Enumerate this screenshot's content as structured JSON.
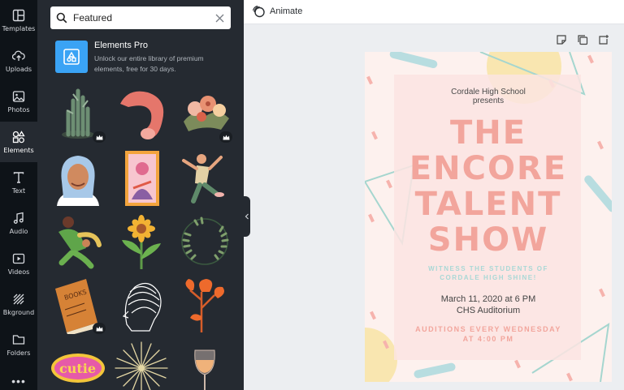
{
  "sidebar": {
    "items": [
      {
        "label": "Templates",
        "icon": "templates-icon"
      },
      {
        "label": "Uploads",
        "icon": "upload-icon"
      },
      {
        "label": "Photos",
        "icon": "image-icon"
      },
      {
        "label": "Elements",
        "icon": "shapes-icon",
        "active": true
      },
      {
        "label": "Text",
        "icon": "text-icon"
      },
      {
        "label": "Audio",
        "icon": "music-icon"
      },
      {
        "label": "Videos",
        "icon": "video-icon"
      },
      {
        "label": "Bkground",
        "icon": "background-icon"
      },
      {
        "label": "Folders",
        "icon": "folder-icon"
      }
    ],
    "more_label": "•••"
  },
  "search": {
    "value": "Featured"
  },
  "promo": {
    "title": "Elements Pro",
    "description_line1": "Unlock our entire library of premium",
    "description_line2": "elements, free for 30 days."
  },
  "elements": [
    {
      "name": "cactus-plant",
      "premium": true
    },
    {
      "name": "pink-arch",
      "premium": false
    },
    {
      "name": "flower-bouquet",
      "premium": true
    },
    {
      "name": "woman-portrait",
      "premium": false
    },
    {
      "name": "tarot-card",
      "premium": false
    },
    {
      "name": "dancing-person",
      "premium": false
    },
    {
      "name": "jumping-person",
      "premium": false
    },
    {
      "name": "sunflower",
      "premium": false
    },
    {
      "name": "leaf-wreath",
      "premium": false
    },
    {
      "name": "books",
      "premium": true
    },
    {
      "name": "line-face",
      "premium": false
    },
    {
      "name": "orange-flowers",
      "premium": false
    },
    {
      "name": "cutie-sticker",
      "premium": false
    },
    {
      "name": "firework",
      "premium": false
    },
    {
      "name": "wine-glass",
      "premium": false
    }
  ],
  "topbar": {
    "animate_label": "Animate"
  },
  "poster": {
    "school_line1": "Cordale High School",
    "school_line2": "presents",
    "title_lines": [
      "THE",
      "ENCORE",
      "TALENT",
      "SHOW"
    ],
    "witness_line1": "WITNESS THE STUDENTS OF",
    "witness_line2": "CORDALE HIGH SHINE!",
    "date": "March 11, 2020 at 6 PM",
    "venue": "CHS Auditorium",
    "auditions_line1": "AUDITIONS EVERY WEDNESDAY",
    "auditions_line2": "AT 4:00 PM"
  },
  "colors": {
    "rail_bg": "#0e1318",
    "panel_bg": "#252a31",
    "accent": "#3aa3f5",
    "poster_pink": "#f2a59c",
    "poster_teal": "#a9d8d6"
  }
}
